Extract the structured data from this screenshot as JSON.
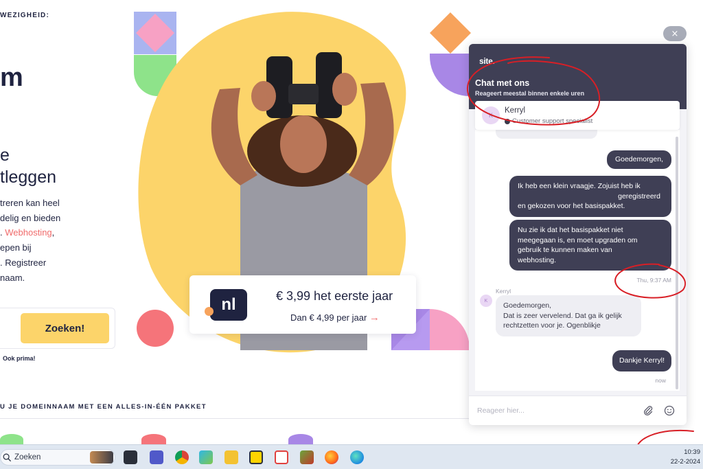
{
  "site": {
    "eyebrow": "WEZIGHEID:",
    "logo_fragment": "m",
    "heading_lines": [
      "e",
      "tleggen"
    ],
    "paragraph": {
      "line1": "treren kan heel",
      "line2": "delig en bieden",
      "line3_prefix": ". ",
      "line3_link": "Webhosting",
      "line3_suffix": ",",
      "line4": "epen bij",
      "line5": ". Registreer",
      "line6": "naam."
    },
    "search_button": "Zoeken!",
    "ok_text": "Ook prima!",
    "section_heading": "U JE DOMEINNAAM MET EEN ALLES-IN-ÉÉN PAKKET"
  },
  "hero": {
    "badge_label": "nl",
    "price_main": "€ 3,99 het eerste jaar",
    "price_sub": "Dan € 4,99 per jaar",
    "arrow": "→"
  },
  "chat": {
    "close_label": "×",
    "logo": "site.",
    "title": "Chat met ons",
    "subtitle": "Reageert meestal binnen enkele uren",
    "agent": {
      "initial": "K",
      "name": "Kerryl",
      "role": "Customer support specialist"
    },
    "messages": {
      "m1": "Goedemorgen,",
      "m2_l1": "Ik heb een klein vraagje. Zojuist heb ik",
      "m2_l2": "geregistreerd",
      "m2_l3": "en gekozen voor het basispakket.",
      "m3_l1": "Nu zie ik dat het basispakket niet",
      "m3_l2": "meegegaan is, en moet upgraden om",
      "m3_l3": "gebruik te kunnen maken van",
      "m3_l4": "webhosting.",
      "time1": "Thu, 9:37 AM",
      "reply_author": "Kerryl",
      "reply_l1": "Goedemorgen,",
      "reply_l2": "Dat is zeer vervelend. Dat ga ik gelijk",
      "reply_l3": "rechtzetten voor je. Ogenblikje",
      "m4": "Dankje Kerryl!",
      "time2": "now"
    },
    "input_placeholder": "Reageer hier..."
  },
  "taskbar": {
    "search_label": "Zoeken",
    "time": "10:39",
    "date": "22-2-2024",
    "apps": [
      "widgets-icon",
      "task-view-icon",
      "teams-icon",
      "chrome-icon",
      "photos-icon",
      "file-explorer-icon",
      "todo-icon",
      "snipping-tool-icon",
      "game-icon",
      "firefox-icon",
      "edge-icon"
    ]
  },
  "colors": {
    "navy": "#1f2340",
    "chat_header": "#3f3f55",
    "yellow": "#fcd46a",
    "coral": "#f06a6a",
    "annotation_red": "#d81f26"
  }
}
